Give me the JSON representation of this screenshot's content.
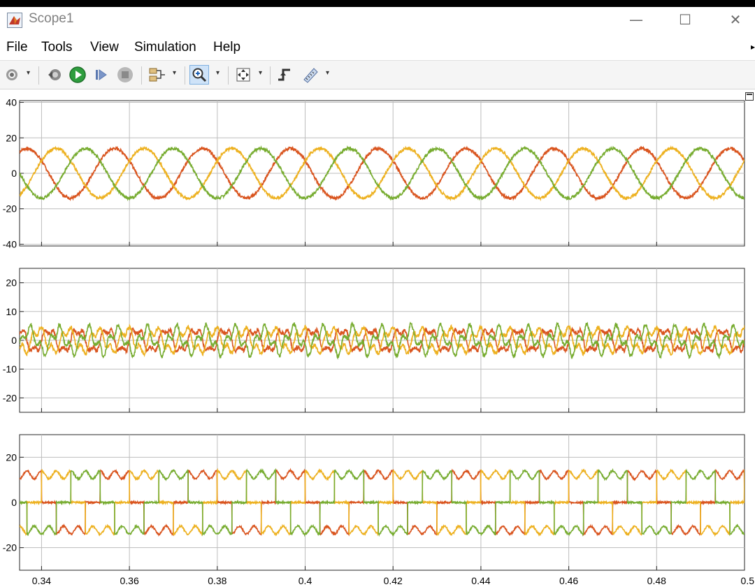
{
  "window": {
    "title": "Scope1",
    "controls": {
      "minimize": "—",
      "maximize": "☐",
      "close": "✕"
    }
  },
  "menu": {
    "items": [
      "File",
      "Tools",
      "View",
      "Simulation",
      "Help"
    ]
  },
  "toolbar": {
    "buttons": [
      {
        "name": "configuration-properties-icon",
        "dropdown": true
      },
      {
        "name": "step-back-icon",
        "dropdown": false
      },
      {
        "name": "run-icon",
        "dropdown": false
      },
      {
        "name": "step-forward-icon",
        "dropdown": false
      },
      {
        "name": "stop-icon",
        "dropdown": false
      },
      {
        "name": "signal-selection-icon",
        "dropdown": true
      },
      {
        "name": "zoom-in-icon",
        "dropdown": true,
        "active": true
      },
      {
        "name": "autoscale-icon",
        "dropdown": true
      },
      {
        "name": "trigger-icon",
        "dropdown": false
      },
      {
        "name": "cursor-measurements-icon",
        "dropdown": true
      }
    ]
  },
  "chart_data": [
    {
      "type": "line",
      "title": "",
      "xlabel": "",
      "ylabel": "",
      "xlim": [
        0.335,
        0.5
      ],
      "ylim": [
        -41,
        41
      ],
      "yticks": [
        "40",
        "20",
        "0",
        "-20",
        "-40"
      ],
      "grid": true,
      "series": [
        {
          "color": "#d9541e",
          "waveform": "sine",
          "amplitude": 14,
          "frequency_hz": 50,
          "phase_deg": 150
        },
        {
          "color": "#edb120",
          "waveform": "sine",
          "amplitude": 14,
          "frequency_hz": 50,
          "phase_deg": 30
        },
        {
          "color": "#77ac30",
          "waveform": "sine",
          "amplitude": 14,
          "frequency_hz": 50,
          "phase_deg": -90
        }
      ]
    },
    {
      "type": "line",
      "title": "",
      "xlabel": "",
      "ylabel": "",
      "xlim": [
        0.335,
        0.5
      ],
      "ylim": [
        -25,
        25
      ],
      "yticks": [
        "20",
        "10",
        "0",
        "-10",
        "-20"
      ],
      "grid": true,
      "series": [
        {
          "color": "#d9541e",
          "waveform": "ripple",
          "amplitude": 6,
          "frequency_hz": 150,
          "phase_deg": 0
        },
        {
          "color": "#edb120",
          "waveform": "ripple",
          "amplitude": 6,
          "frequency_hz": 150,
          "phase_deg": 120
        },
        {
          "color": "#77ac30",
          "waveform": "ripple",
          "amplitude": 6,
          "frequency_hz": 150,
          "phase_deg": 240
        }
      ]
    },
    {
      "type": "line",
      "title": "",
      "xlabel": "",
      "ylabel": "",
      "xlim": [
        0.335,
        0.5
      ],
      "ylim": [
        -30,
        30
      ],
      "yticks": [
        "20",
        "0",
        "-20"
      ],
      "grid": true,
      "xticks": [
        "0.34",
        "0.36",
        "0.38",
        "0.4",
        "0.42",
        "0.44",
        "0.46",
        "0.48",
        "0.5"
      ],
      "series": [
        {
          "color": "#d9541e",
          "waveform": "six-step",
          "amplitude": 14,
          "frequency_hz": 50,
          "phase_deg": 150
        },
        {
          "color": "#edb120",
          "waveform": "six-step",
          "amplitude": 14,
          "frequency_hz": 50,
          "phase_deg": 30
        },
        {
          "color": "#77ac30",
          "waveform": "six-step",
          "amplitude": 14,
          "frequency_hz": 50,
          "phase_deg": -90
        }
      ]
    }
  ]
}
